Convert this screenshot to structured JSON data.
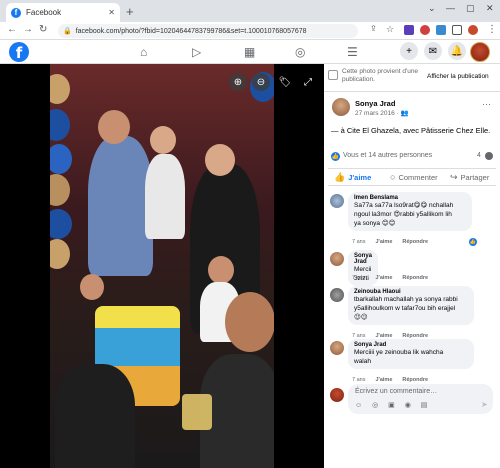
{
  "browser": {
    "tab_title": "Facebook",
    "tab_favicon": "f",
    "url": "facebook.com/photo/?fbid=10204644783799786&set=t.100010768057678",
    "controls": {
      "minimize": "—",
      "maximize": "▢",
      "close": "✕"
    }
  },
  "fb_nav": {
    "logo": "f",
    "icons": [
      "home-icon",
      "video-icon",
      "marketplace-icon",
      "groups-icon",
      "menu-icon"
    ],
    "right_icons": [
      "plus-icon",
      "messenger-icon",
      "bell-icon",
      "profile-avatar"
    ]
  },
  "viewer": {
    "zoom_in": "⊕",
    "zoom_out": "⊖",
    "tag": "🏷",
    "fullscreen": "⤢"
  },
  "owner_notice": {
    "text": "Cette photo provient d'une publication.",
    "link": "Afficher la publication"
  },
  "post": {
    "author": "Sonya Jrad",
    "date": "27 mars 2016 · 👥",
    "more": "···",
    "caption": "— à Cite El Ghazela, avec Pâtisserie Chez Elle."
  },
  "reactions": {
    "summary": "Vous et 14 autres personnes",
    "comment_count": "4"
  },
  "actions": {
    "like": "J'aime",
    "comment": "Commenter",
    "share": "Partager"
  },
  "comments": [
    {
      "author": "Imen Benslama",
      "lines": [
        "Sa77a sa77a lso9rat😋😋 nchallah",
        "ngoul la3mor 😍rabbi y5allikom lih",
        "ya sonya 😊😊"
      ],
      "time": "7 ans",
      "like": "J'aime",
      "reply": "Répondre"
    },
    {
      "author": "Sonya Jrad",
      "lines": [
        "Mercii 3zizti"
      ],
      "time": "7 ans",
      "like": "J'aime",
      "reply": "Répondre"
    },
    {
      "author": "Zeinouba Hlaoui",
      "lines": [
        "tbarkallah machallah ya sonya rabbi",
        "y5allihoulkom w tafar7ou bih erajjel",
        "😉😉"
      ],
      "time": "7 ans",
      "like": "J'aime",
      "reply": "Répondre"
    },
    {
      "author": "Sonya Jrad",
      "lines": [
        "Merciiii ye zeinouba lik wahcha",
        "walah"
      ],
      "time": "7 ans",
      "like": "J'aime",
      "reply": "Répondre"
    }
  ],
  "composer": {
    "placeholder": "Écrivez un commentaire…",
    "tools": "☺ ◎ ▣ ◉ ▤",
    "send": "➤"
  },
  "colors": {
    "fb_blue": "#1877f2",
    "bubble": "#f0f2f5",
    "secondary_text": "#65676b"
  }
}
